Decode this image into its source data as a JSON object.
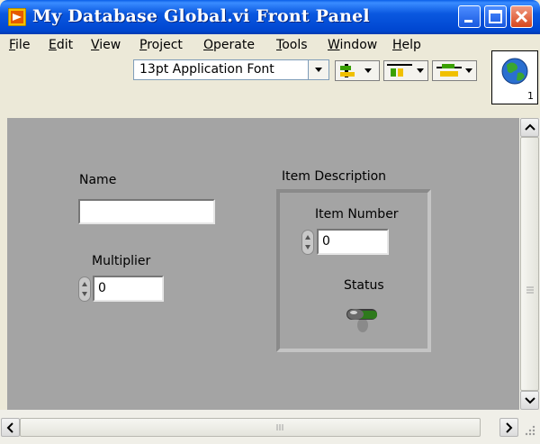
{
  "window": {
    "title": "My Database Global.vi Front Panel"
  },
  "menu": [
    {
      "label": "File",
      "mnemonic": "F",
      "rest": "ile"
    },
    {
      "label": "Edit",
      "mnemonic": "E",
      "rest": "dit"
    },
    {
      "label": "View",
      "mnemonic": "V",
      "rest": "iew"
    },
    {
      "label": "Project",
      "mnemonic": "P",
      "rest": "roject"
    },
    {
      "label": "Operate",
      "mnemonic": "O",
      "rest": "perate"
    },
    {
      "label": "Tools",
      "mnemonic": "T",
      "rest": "ools"
    },
    {
      "label": "Window",
      "mnemonic": "W",
      "rest": "indow"
    },
    {
      "label": "Help",
      "mnemonic": "H",
      "rest": "elp"
    }
  ],
  "toolbar": {
    "font_select": "13pt Application Font",
    "tools": [
      "align-objects-icon",
      "distribute-objects-icon",
      "resize-objects-icon"
    ]
  },
  "connector_pane": {
    "number": "1"
  },
  "panel": {
    "name_label": "Name",
    "name_value": "",
    "multiplier_label": "Multiplier",
    "multiplier_value": "0",
    "cluster_label": "Item Description",
    "item_number_label": "Item Number",
    "item_number_value": "0",
    "status_label": "Status"
  },
  "colors": {
    "titlebar": "#0a58e0",
    "panel_bg": "#a4a4a4",
    "window_bg": "#ece9d8"
  }
}
